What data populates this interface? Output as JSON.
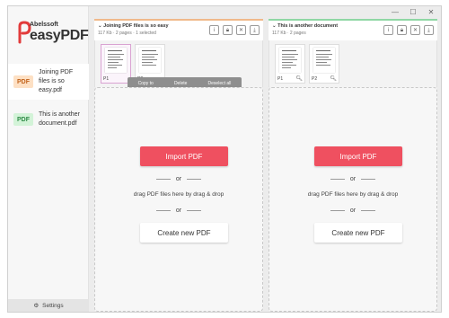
{
  "app": {
    "logo_small": "Abelssoft",
    "logo_main": "easyPDF",
    "window_controls": [
      "—",
      "☐",
      "✕"
    ]
  },
  "sidebar": {
    "items": [
      {
        "badge": "PDF",
        "name": "Joining PDF files is so easy.pdf",
        "badge_color": "#fde0c4"
      },
      {
        "badge": "PDF",
        "name": "This is another document.pdf",
        "badge_color": "#d3f3d8"
      }
    ],
    "settings_label": "Settings"
  },
  "panels": [
    {
      "title": "Joining PDF files is so easy",
      "subtitle": "117 Kb · 2 pages · 1 selected",
      "accent": "#f0b98a",
      "pages": [
        "P1",
        "P2"
      ],
      "actions": [
        "Copy to",
        "Delete",
        "Deselect all"
      ],
      "import_label": "Import PDF",
      "or_label": "or",
      "drag_label": "drag PDF files here by drag & drop",
      "create_label": "Create new PDF"
    },
    {
      "title": "This is another document",
      "subtitle": "117 Kb · 2 pages",
      "accent": "#8fd7a4",
      "pages": [
        "P1",
        "P2"
      ],
      "import_label": "Import PDF",
      "or_label": "or",
      "drag_label": "drag PDF files here by drag & drop",
      "create_label": "Create new PDF"
    }
  ],
  "colors": {
    "import_button": "#ef5060",
    "logo_red": "#e23b3b"
  }
}
